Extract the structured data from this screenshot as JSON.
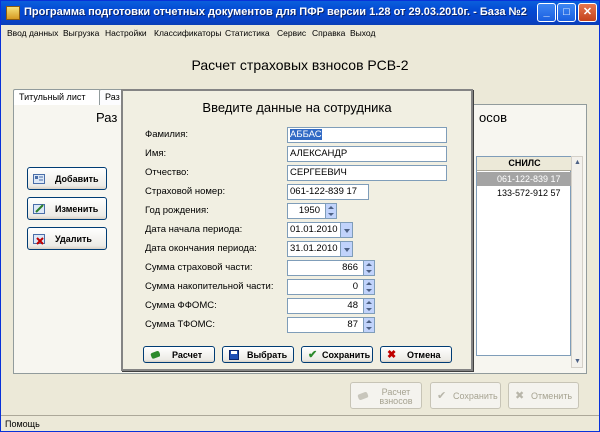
{
  "window": {
    "title": "Программа подготовки отчетных документов для ПФР версии 1.28 от 29.03.2010г. - База №2"
  },
  "menu": [
    "Ввод данных",
    "Выгрузка",
    "Настройки",
    "Классификаторы",
    "Статистика",
    "Сервис",
    "Справка",
    "Выход"
  ],
  "main": {
    "title": "Расчет страховых взносов РСВ-2",
    "tabs": [
      "Титульный лист",
      "Раз"
    ],
    "heading_left": "Раз",
    "heading_right": "осов"
  },
  "side_buttons": {
    "add": "Добавить",
    "edit": "Изменить",
    "delete": "Удалить"
  },
  "grid": {
    "column": "СНИЛС",
    "rows": [
      "061-122-839 17",
      "133-572-912 57"
    ]
  },
  "bottom_buttons": {
    "calc": "Расчет взносов",
    "save": "Сохранить",
    "cancel": "Отменить"
  },
  "status": "Помощь",
  "dialog": {
    "title": "Введите данные на сотрудника",
    "labels": {
      "surname": "Фамилия:",
      "name": "Имя:",
      "patronymic": "Отчество:",
      "insurance_number": "Страховой номер:",
      "birth_year": "Год рождения:",
      "period_start": "Дата начала периода:",
      "period_end": "Дата окончания периода:",
      "insurance_part": "Сумма страховой части:",
      "funded_part": "Сумма накопительной части:",
      "ffoms": "Сумма ФФОМС:",
      "tfoms": "Сумма ТФОМС:"
    },
    "values": {
      "surname": "АББАС",
      "name": "АЛЕКСАНДР",
      "patronymic": "СЕРГЕЕВИЧ",
      "insurance_number": "061-122-839 17",
      "birth_year": "1950",
      "period_start": "01.01.2010",
      "period_end": "31.01.2010",
      "insurance_part": "866",
      "funded_part": "0",
      "ffoms": "48",
      "tfoms": "87"
    },
    "buttons": {
      "calc": "Расчет",
      "select": "Выбрать",
      "save": "Сохранить",
      "cancel": "Отмена"
    }
  },
  "colors": {
    "titlebar": "#0a5fdc",
    "selection": "#316ac5",
    "accent_green": "#2c8a2c",
    "accent_red": "#c00000"
  }
}
